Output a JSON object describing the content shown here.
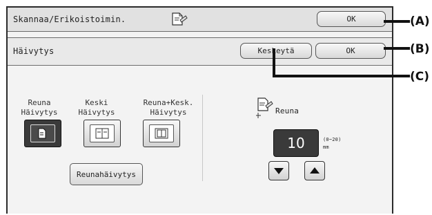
{
  "header": {
    "title": "Skannaa/Erikoistoimin.",
    "ok_label": "OK"
  },
  "subheader": {
    "title": "Häivytys",
    "cancel_label": "Keskeytä",
    "ok_label": "OK"
  },
  "modes": [
    {
      "label_line1": "Reuna",
      "label_line2": "Häivytys",
      "selected": true
    },
    {
      "label_line1": "Keski",
      "label_line2": "Häivytys",
      "selected": false
    },
    {
      "label_line1": "Reuna+Kesk.",
      "label_line2": "Häivytys",
      "selected": false
    }
  ],
  "edge_button_label": "Reunahäivytys",
  "edge": {
    "label": "Reuna",
    "value": "10",
    "range": "(0~20)",
    "unit": "mm"
  },
  "callouts": {
    "a": "(A)",
    "b": "(B)",
    "c": "(C)"
  },
  "icons": {
    "header": "scan-page-icon",
    "edge": "edge-erase-icon",
    "modes": [
      "edge-erase-mode-icon",
      "center-erase-mode-icon",
      "edge-center-erase-mode-icon"
    ],
    "down": "triangle-down-icon",
    "up": "triangle-up-icon"
  },
  "colors": {
    "selected": "#3a3a3a",
    "panel": "#f3f3f3",
    "header": "#e1e1e1"
  }
}
